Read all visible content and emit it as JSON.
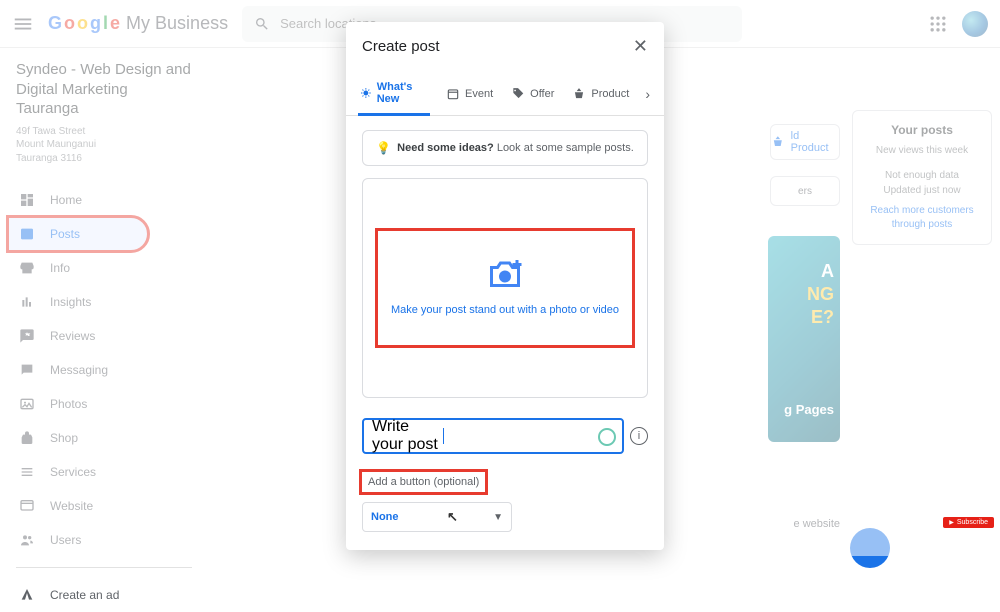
{
  "header": {
    "logo_rest": "My Business",
    "search_placeholder": "Search locations"
  },
  "business": {
    "name": "Syndeo - Web Design and Digital Marketing Tauranga",
    "addr1": "49f Tawa Street",
    "addr2": "Mount Maunganui",
    "addr3": "Tauranga 3116"
  },
  "nav": {
    "home": "Home",
    "posts": "Posts",
    "info": "Info",
    "insights": "Insights",
    "reviews": "Reviews",
    "messaging": "Messaging",
    "photos": "Photos",
    "shop": "Shop",
    "services": "Services",
    "website": "Website",
    "users": "Users",
    "createad": "Create an ad"
  },
  "modal": {
    "title": "Create post",
    "tabs": {
      "whatsnew": "What's New",
      "event": "Event",
      "offer": "Offer",
      "product": "Product"
    },
    "ideas_bold": "Need some ideas?",
    "ideas_rest": " Look at some sample posts.",
    "upload_text": "Make your post stand out with a photo or video",
    "field_label": "Write your post",
    "addbutton_label": "Add a button (optional)",
    "dropdown_value": "None"
  },
  "right": {
    "add_product": "ld Product",
    "offers": "ers",
    "yourposts_title": "Your posts",
    "views_label": "New views this week",
    "not_enough": "Not enough data",
    "updated": "Updated just now",
    "reach": "Reach more customers through posts",
    "promo_a": "A",
    "promo_ng": "NG",
    "promo_e": "E?",
    "promo_pages": "g Pages",
    "website": "e website"
  },
  "yt": "Subscribe"
}
